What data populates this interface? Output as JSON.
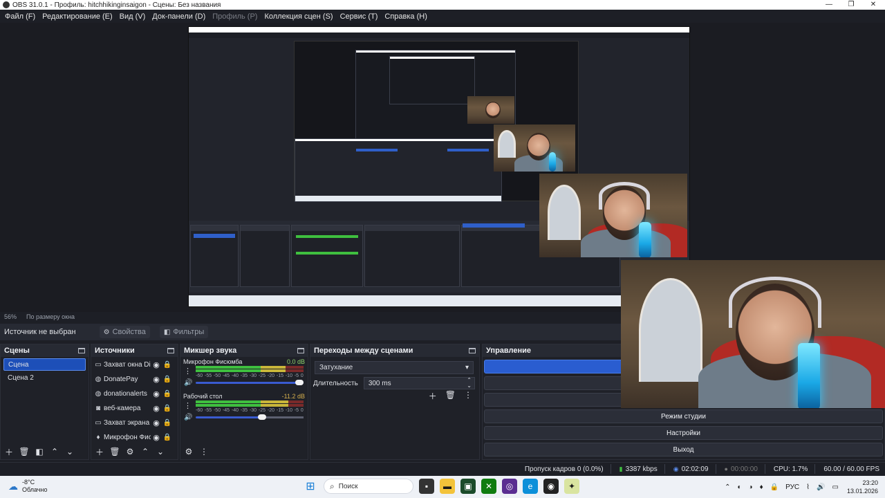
{
  "window": {
    "title": "OBS 31.0.1 - Профиль: hitchhikinginsaigon - Сцены: Без названия",
    "controls": [
      "—",
      "❐",
      "✕"
    ]
  },
  "menu": [
    {
      "label": "Файл (F)",
      "disabled": false
    },
    {
      "label": "Редактирование (E)",
      "disabled": false
    },
    {
      "label": "Вид (V)",
      "disabled": false
    },
    {
      "label": "Док-панели (D)",
      "disabled": false
    },
    {
      "label": "Профиль (P)",
      "disabled": true
    },
    {
      "label": "Коллекция сцен (S)",
      "disabled": false
    },
    {
      "label": "Сервис (T)",
      "disabled": false
    },
    {
      "label": "Справка (H)",
      "disabled": false
    }
  ],
  "preview_status": {
    "zoom": "56%",
    "scale_mode": "По размеру окна"
  },
  "context_bar": {
    "no_source": "Источник не выбран",
    "properties": "Свойства",
    "filters": "Фильтры"
  },
  "scenes": {
    "title": "Сцены",
    "items": [
      "Сцена",
      "Сцена 2"
    ],
    "active_index": 0
  },
  "sources": {
    "title": "Источники",
    "items": [
      {
        "name": "Захват окна Disc",
        "icon": "window-capture-icon"
      },
      {
        "name": "DonatePay",
        "icon": "browser-source-icon"
      },
      {
        "name": "donationalerts",
        "icon": "browser-source-icon"
      },
      {
        "name": "веб-камера",
        "icon": "camera-icon"
      },
      {
        "name": "Захват экрана",
        "icon": "display-capture-icon"
      },
      {
        "name": "Микрофон Фиск",
        "icon": "microphone-icon"
      }
    ]
  },
  "mixer": {
    "title": "Микшер звука",
    "ticks": [
      "-60",
      "-55",
      "-50",
      "-45",
      "-40",
      "-35",
      "-30",
      "-25",
      "-20",
      "-15",
      "-10",
      "-5",
      "0"
    ],
    "channels": [
      {
        "name": "Микрофон Фисюмба",
        "db": "0.0 dB",
        "level": 0.81,
        "volume": 1.0
      },
      {
        "name": "Рабочий стол",
        "db": "-11.2 dB",
        "level": 0.86,
        "volume": 0.62
      }
    ]
  },
  "transitions": {
    "title": "Переходы между сценами",
    "selected": "Затухание",
    "duration_label": "Длительность",
    "duration_value": "300 ms"
  },
  "controls": {
    "title": "Управление",
    "buttons": [
      "Режим студии",
      "Настройки",
      "Выход"
    ]
  },
  "statusbar": {
    "dropped": "Пропуск кадров 0 (0.0%)",
    "bitrate": "3387 kbps",
    "stream_time": "02:02:09",
    "rec_time": "00:00:00",
    "cpu": "CPU: 1.7%",
    "fps": "60.00 / 60.00 FPS"
  },
  "taskbar": {
    "temperature": "-8°C",
    "weather": "Облачно",
    "search": "Поиск",
    "lang": "РУС",
    "time": "23:20",
    "date": "13.01.2026"
  },
  "colors": {
    "accent": "#2a5dd0",
    "panel_bg": "#1f2128",
    "meter_green": "#3fbf3f",
    "meter_yellow": "#c9b63a",
    "meter_red": "#c93a3a"
  }
}
